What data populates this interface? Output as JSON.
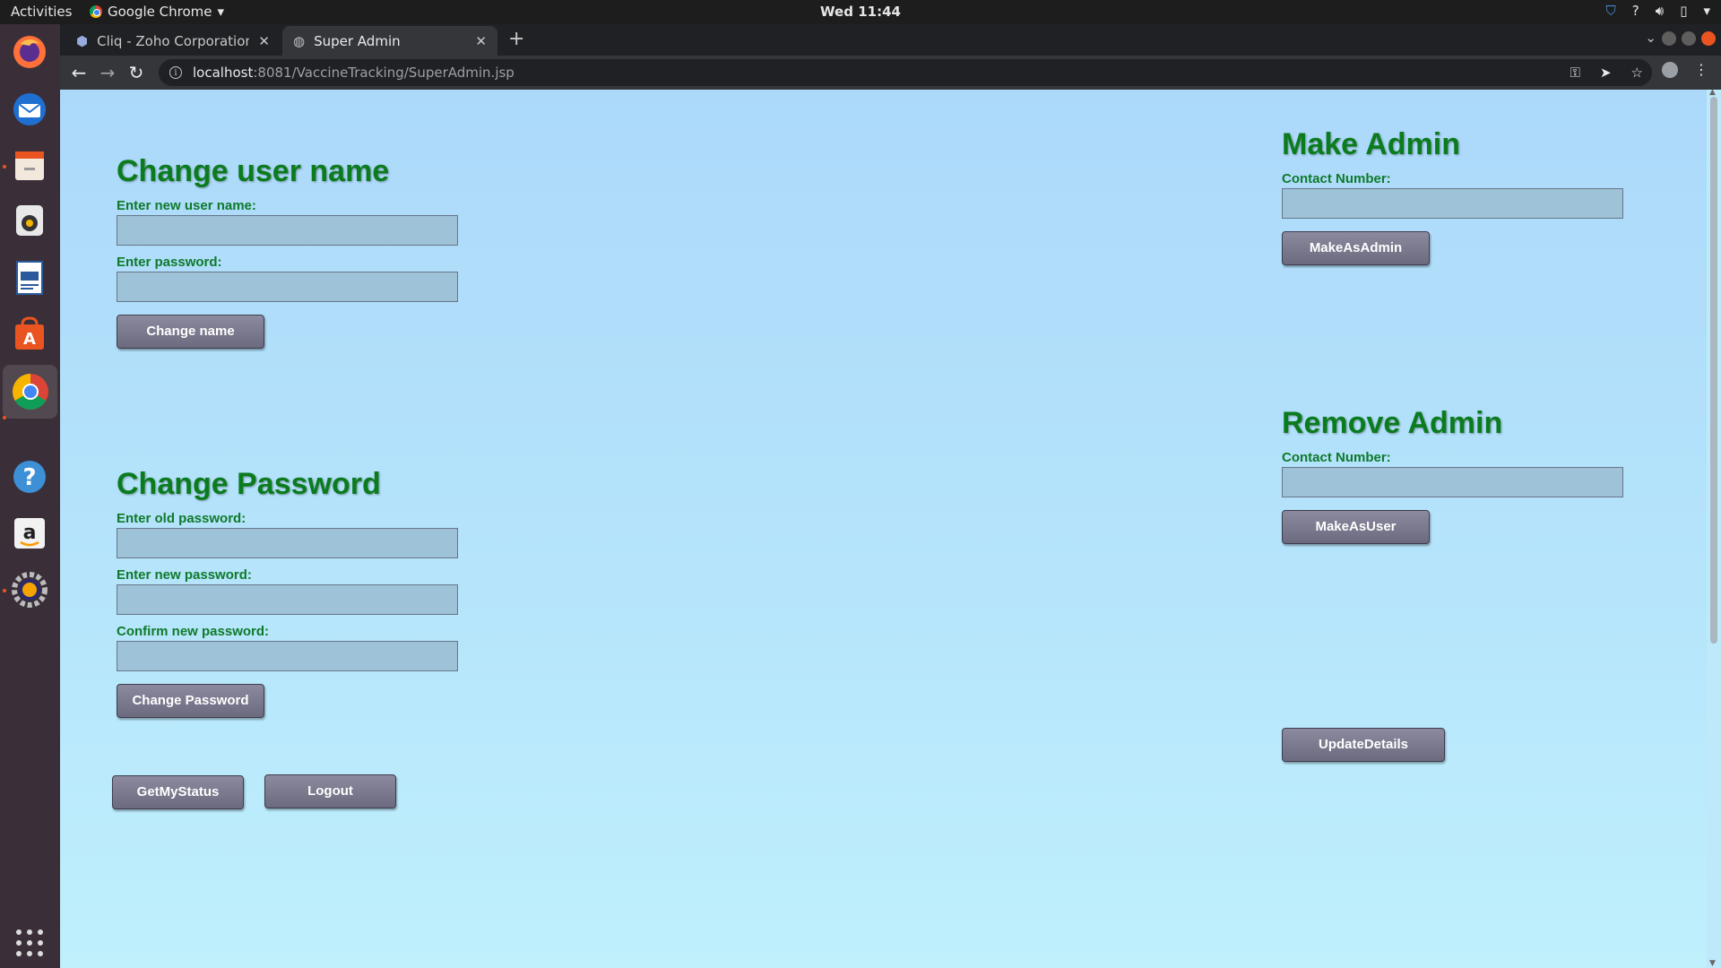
{
  "system": {
    "activities": "Activities",
    "app_name": "Google Chrome",
    "clock": "Wed 11:44"
  },
  "browser": {
    "tabs": [
      {
        "title": "Cliq - Zoho Corporation P",
        "active": false
      },
      {
        "title": "Super Admin",
        "active": true
      }
    ],
    "url_host": "localhost",
    "url_rest": ":8081/VaccineTracking/SuperAdmin.jsp"
  },
  "change_user_name": {
    "title": "Change user name",
    "new_name_label": "Enter new user name:",
    "password_label": "Enter password:",
    "submit_label": "Change name"
  },
  "change_password": {
    "title": "Change Password",
    "old_label": "Enter old password:",
    "new_label": "Enter new password:",
    "confirm_label": "Confirm new password:",
    "submit_label": "Change Password"
  },
  "bottom_buttons": {
    "status_label": "GetMyStatus",
    "logout_label": "Logout"
  },
  "make_admin": {
    "title": "Make Admin",
    "contact_label": "Contact Number:",
    "submit_label": "MakeAsAdmin"
  },
  "remove_admin": {
    "title": "Remove Admin",
    "contact_label": "Contact Number:",
    "submit_label": "MakeAsUser"
  },
  "update": {
    "submit_label": "UpdateDetails"
  },
  "colors": {
    "heading_green": "#0b7c1e",
    "label_green": "#0e7a2a",
    "page_bg_top": "#acd9fa",
    "button_bg": "#7a798d"
  }
}
